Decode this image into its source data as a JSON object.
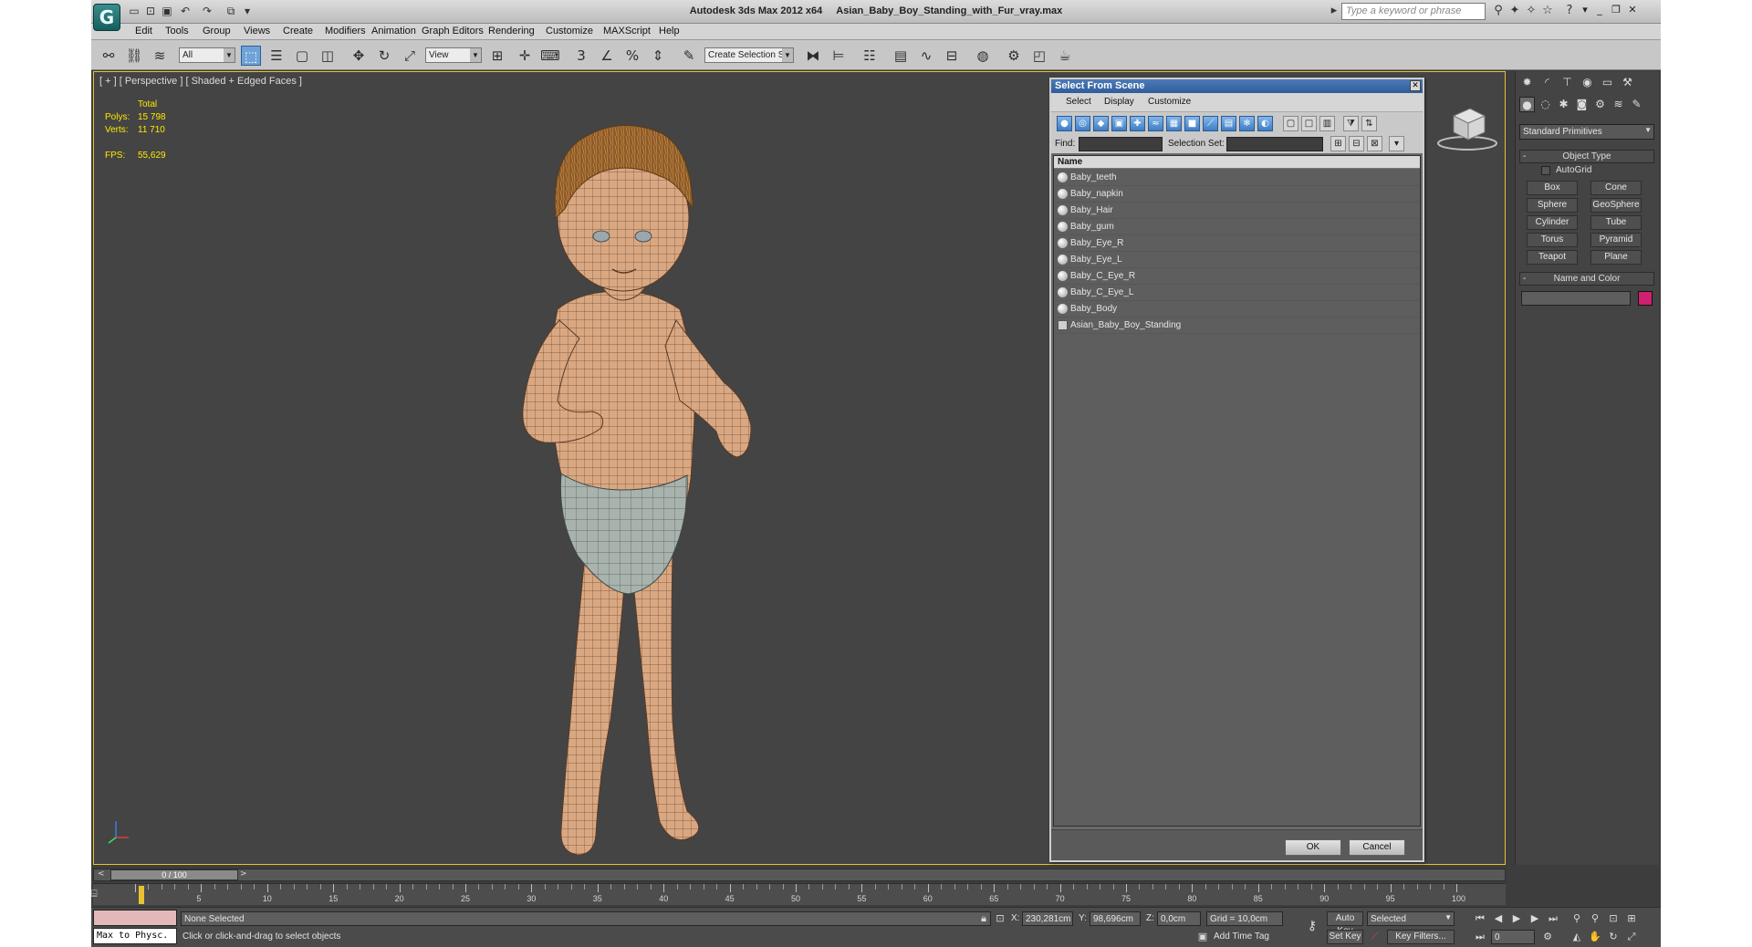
{
  "window": {
    "app_title": "Autodesk 3ds Max  2012 x64",
    "file_name": "Asian_Baby_Boy_Standing_with_Fur_vray.max",
    "search_placeholder": "Type a keyword or phrase"
  },
  "menu": [
    "Edit",
    "Tools",
    "Group",
    "Views",
    "Create",
    "Modifiers",
    "Animation",
    "Graph Editors",
    "Rendering",
    "Customize",
    "MAXScript",
    "Help"
  ],
  "toolbar": {
    "selection_filter": "All",
    "ref_coord": "View",
    "selection_set_placeholder": "Create Selection Se"
  },
  "viewport": {
    "label": "[ + ] [ Perspective ] [ Shaded + Edged Faces ]",
    "stats": {
      "total_label": "Total",
      "polys_label": "Polys:",
      "polys_value": "15 798",
      "verts_label": "Verts:",
      "verts_value": "11 710",
      "fps_label": "FPS:",
      "fps_value": "55,629"
    }
  },
  "dialog": {
    "title": "Select From Scene",
    "menus": [
      "Select",
      "Display",
      "Customize"
    ],
    "find_label": "Find:",
    "selection_set_label": "Selection Set:",
    "column_name": "Name",
    "items": [
      "Baby_teeth",
      "Baby_napkin",
      "Baby_Hair",
      "Baby_gum",
      "Baby_Eye_R",
      "Baby_Eye_L",
      "Baby_C_Eye_R",
      "Baby_C_Eye_L",
      "Baby_Body",
      "Asian_Baby_Boy_Standing"
    ],
    "ok": "OK",
    "cancel": "Cancel"
  },
  "command_panel": {
    "category": "Standard Primitives",
    "object_type_title": "Object Type",
    "autogrid": "AutoGrid",
    "primitives": [
      "Box",
      "Cone",
      "Sphere",
      "GeoSphere",
      "Cylinder",
      "Tube",
      "Torus",
      "Pyramid",
      "Teapot",
      "Plane"
    ],
    "name_color_title": "Name and Color",
    "object_color": "#d0206e"
  },
  "timeline": {
    "slider_label": "0 / 100",
    "ticks": [
      "5",
      "10",
      "15",
      "20",
      "25",
      "30",
      "35",
      "40",
      "45",
      "50",
      "55",
      "60",
      "65",
      "70",
      "75",
      "80",
      "85",
      "90",
      "95",
      "100"
    ]
  },
  "status": {
    "maxscript_output": "Max to Physc.",
    "selection": "None Selected",
    "prompt": "Click or click-and-drag to select objects",
    "x_label": "X:",
    "x_value": "230,281cm",
    "y_label": "Y:",
    "y_value": "98,696cm",
    "z_label": "Z:",
    "z_value": "0,0cm",
    "grid": "Grid = 10,0cm",
    "add_time_tag": "Add Time Tag",
    "auto_key": "Auto Key",
    "set_key": "Set Key",
    "key_mode": "Selected",
    "key_filters": "Key Filters...",
    "frame": "0"
  }
}
